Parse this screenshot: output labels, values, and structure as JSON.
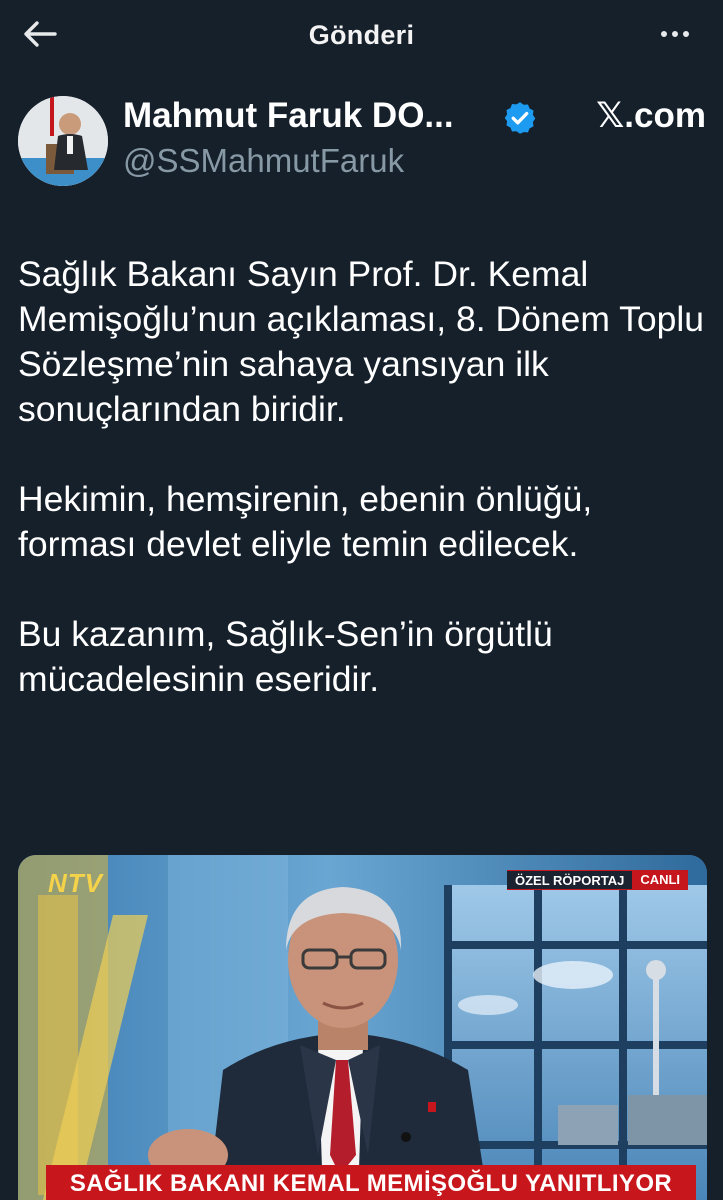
{
  "header": {
    "title": "Gönderi",
    "back_icon": "arrow-left-icon",
    "more_icon": "more-dots-icon"
  },
  "author": {
    "display_name": "Mahmut Faruk DO...",
    "handle": "@SSMahmutFaruk",
    "verified": true,
    "verified_color": "#1d9bf0",
    "source_label": "𝕏.com"
  },
  "tweet": {
    "paragraphs": [
      "Sağlık Bakanı Sayın Prof. Dr. Kemal Memişoğlu’nun açıklaması, 8. Dönem Toplu Sözleşme’nin sahaya yansıyan ilk sonuçlarından biridir.",
      "Hekimin, hemşirenin, ebenin önlüğü, forması devlet eliyle temin edilecek.",
      "Bu kazanım, Sağlık-Sen’in örgütlü mücadelesinin eseridir."
    ]
  },
  "media": {
    "channel_logo": "NTV",
    "tag_special": "ÖZEL RÖPORTAJ",
    "tag_live": "CANLI",
    "lower_third": "SAĞLIK BAKANI KEMAL MEMİŞOĞLU YANITLIYOR",
    "lower_third_color": "#c8161d"
  },
  "theme": {
    "background": "#15202b",
    "secondary_text": "#8899a6"
  }
}
